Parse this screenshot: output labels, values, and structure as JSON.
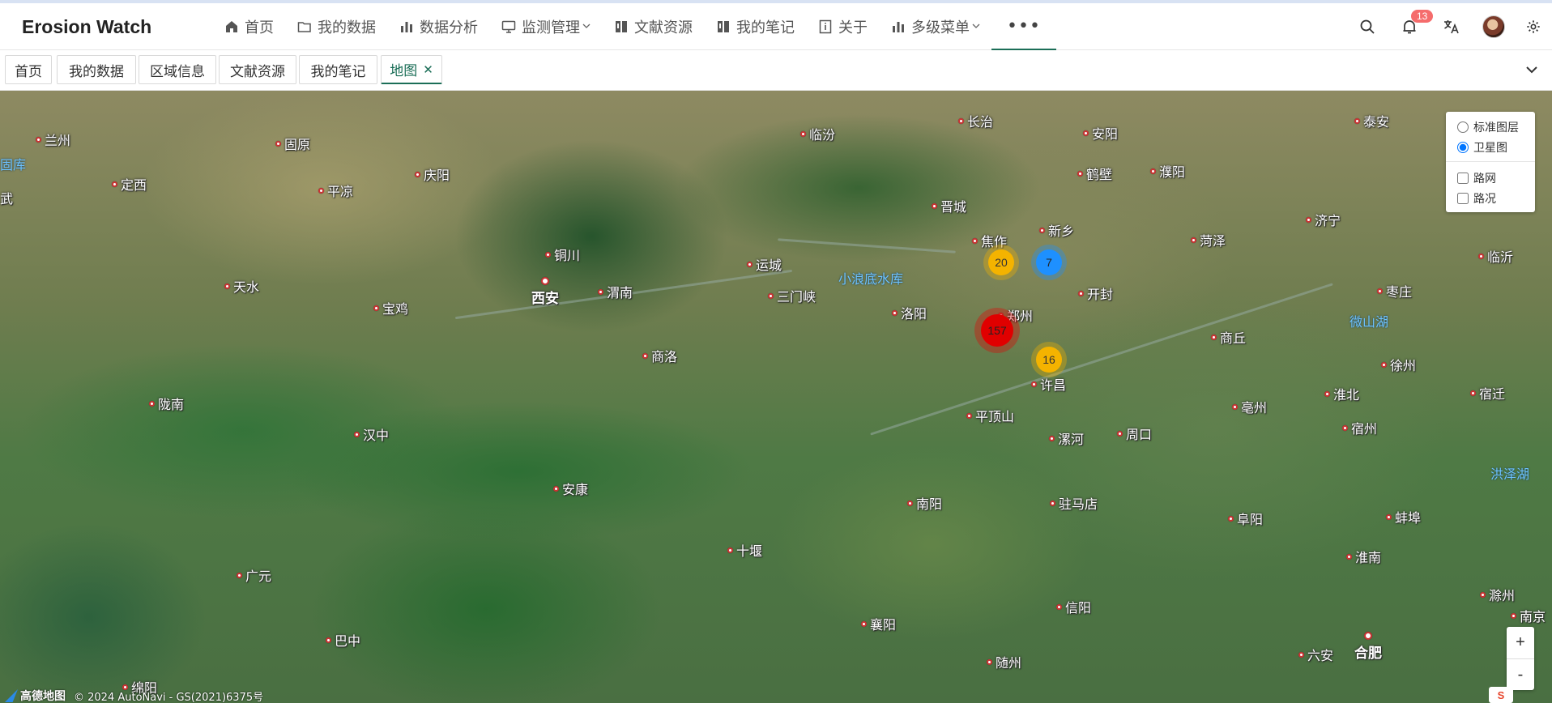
{
  "app": {
    "title": "Erosion Watch"
  },
  "nav": [
    {
      "label": "首页",
      "icon": "home-icon"
    },
    {
      "label": "我的数据",
      "icon": "folder-icon"
    },
    {
      "label": "数据分析",
      "icon": "bar-chart-icon"
    },
    {
      "label": "监测管理",
      "icon": "monitor-icon",
      "dropdown": true
    },
    {
      "label": "文献资源",
      "icon": "book-icon"
    },
    {
      "label": "我的笔记",
      "icon": "notebook-icon"
    },
    {
      "label": "关于",
      "icon": "info-icon"
    },
    {
      "label": "多级菜单",
      "icon": "bar-chart-icon",
      "dropdown": true
    },
    {
      "label": "•••",
      "icon": "more-icon"
    }
  ],
  "header_right": {
    "notification_count": "13"
  },
  "tabs": [
    {
      "label": "首页"
    },
    {
      "label": "我的数据"
    },
    {
      "label": "区域信息"
    },
    {
      "label": "文献资源"
    },
    {
      "label": "我的笔记"
    },
    {
      "label": "地图",
      "active": true,
      "closable": true
    }
  ],
  "map": {
    "layers": {
      "base": [
        {
          "label": "标准图层",
          "checked": false
        },
        {
          "label": "卫星图",
          "checked": true
        }
      ],
      "overlay": [
        {
          "label": "路网",
          "checked": false
        },
        {
          "label": "路况",
          "checked": false
        }
      ]
    },
    "clusters": [
      {
        "count": "20",
        "color": "#f4b300"
      },
      {
        "count": "7",
        "color": "#1e90ff"
      },
      {
        "count": "157",
        "color": "#e00000"
      },
      {
        "count": "16",
        "color": "#f4b300"
      }
    ],
    "cities": [
      "兰州",
      "固原",
      "庆阳",
      "定西",
      "平凉",
      "天水",
      "宝鸡",
      "铜川",
      "渭南",
      "西安",
      "商洛",
      "陇南",
      "汉中",
      "安康",
      "十堰",
      "广元",
      "巴中",
      "绵阳",
      "临汾",
      "长治",
      "安阳",
      "鹤壁",
      "濮阳",
      "晋城",
      "焦作",
      "新乡",
      "运城",
      "三门峡",
      "洛阳",
      "郑州",
      "开封",
      "许昌",
      "平顶山",
      "漯河",
      "周口",
      "南阳",
      "驻马店",
      "信阳",
      "襄阳",
      "随州",
      "泰安",
      "济宁",
      "菏泽",
      "临沂",
      "枣庄",
      "商丘",
      "徐州",
      "淮北",
      "宿迁",
      "亳州",
      "宿州",
      "阜阳",
      "蚌埠",
      "淮南",
      "滁州",
      "六安",
      "合肥",
      "南京",
      "固库",
      "武",
      "南"
    ],
    "water": [
      "小浪底水库",
      "微山湖",
      "洪泽湖"
    ],
    "zoom_in": "+",
    "zoom_out": "-",
    "attribution": {
      "brand": "高德地图",
      "text": "© 2024 AutoNavi - GS(2021)6375号"
    },
    "sogou": "S"
  }
}
